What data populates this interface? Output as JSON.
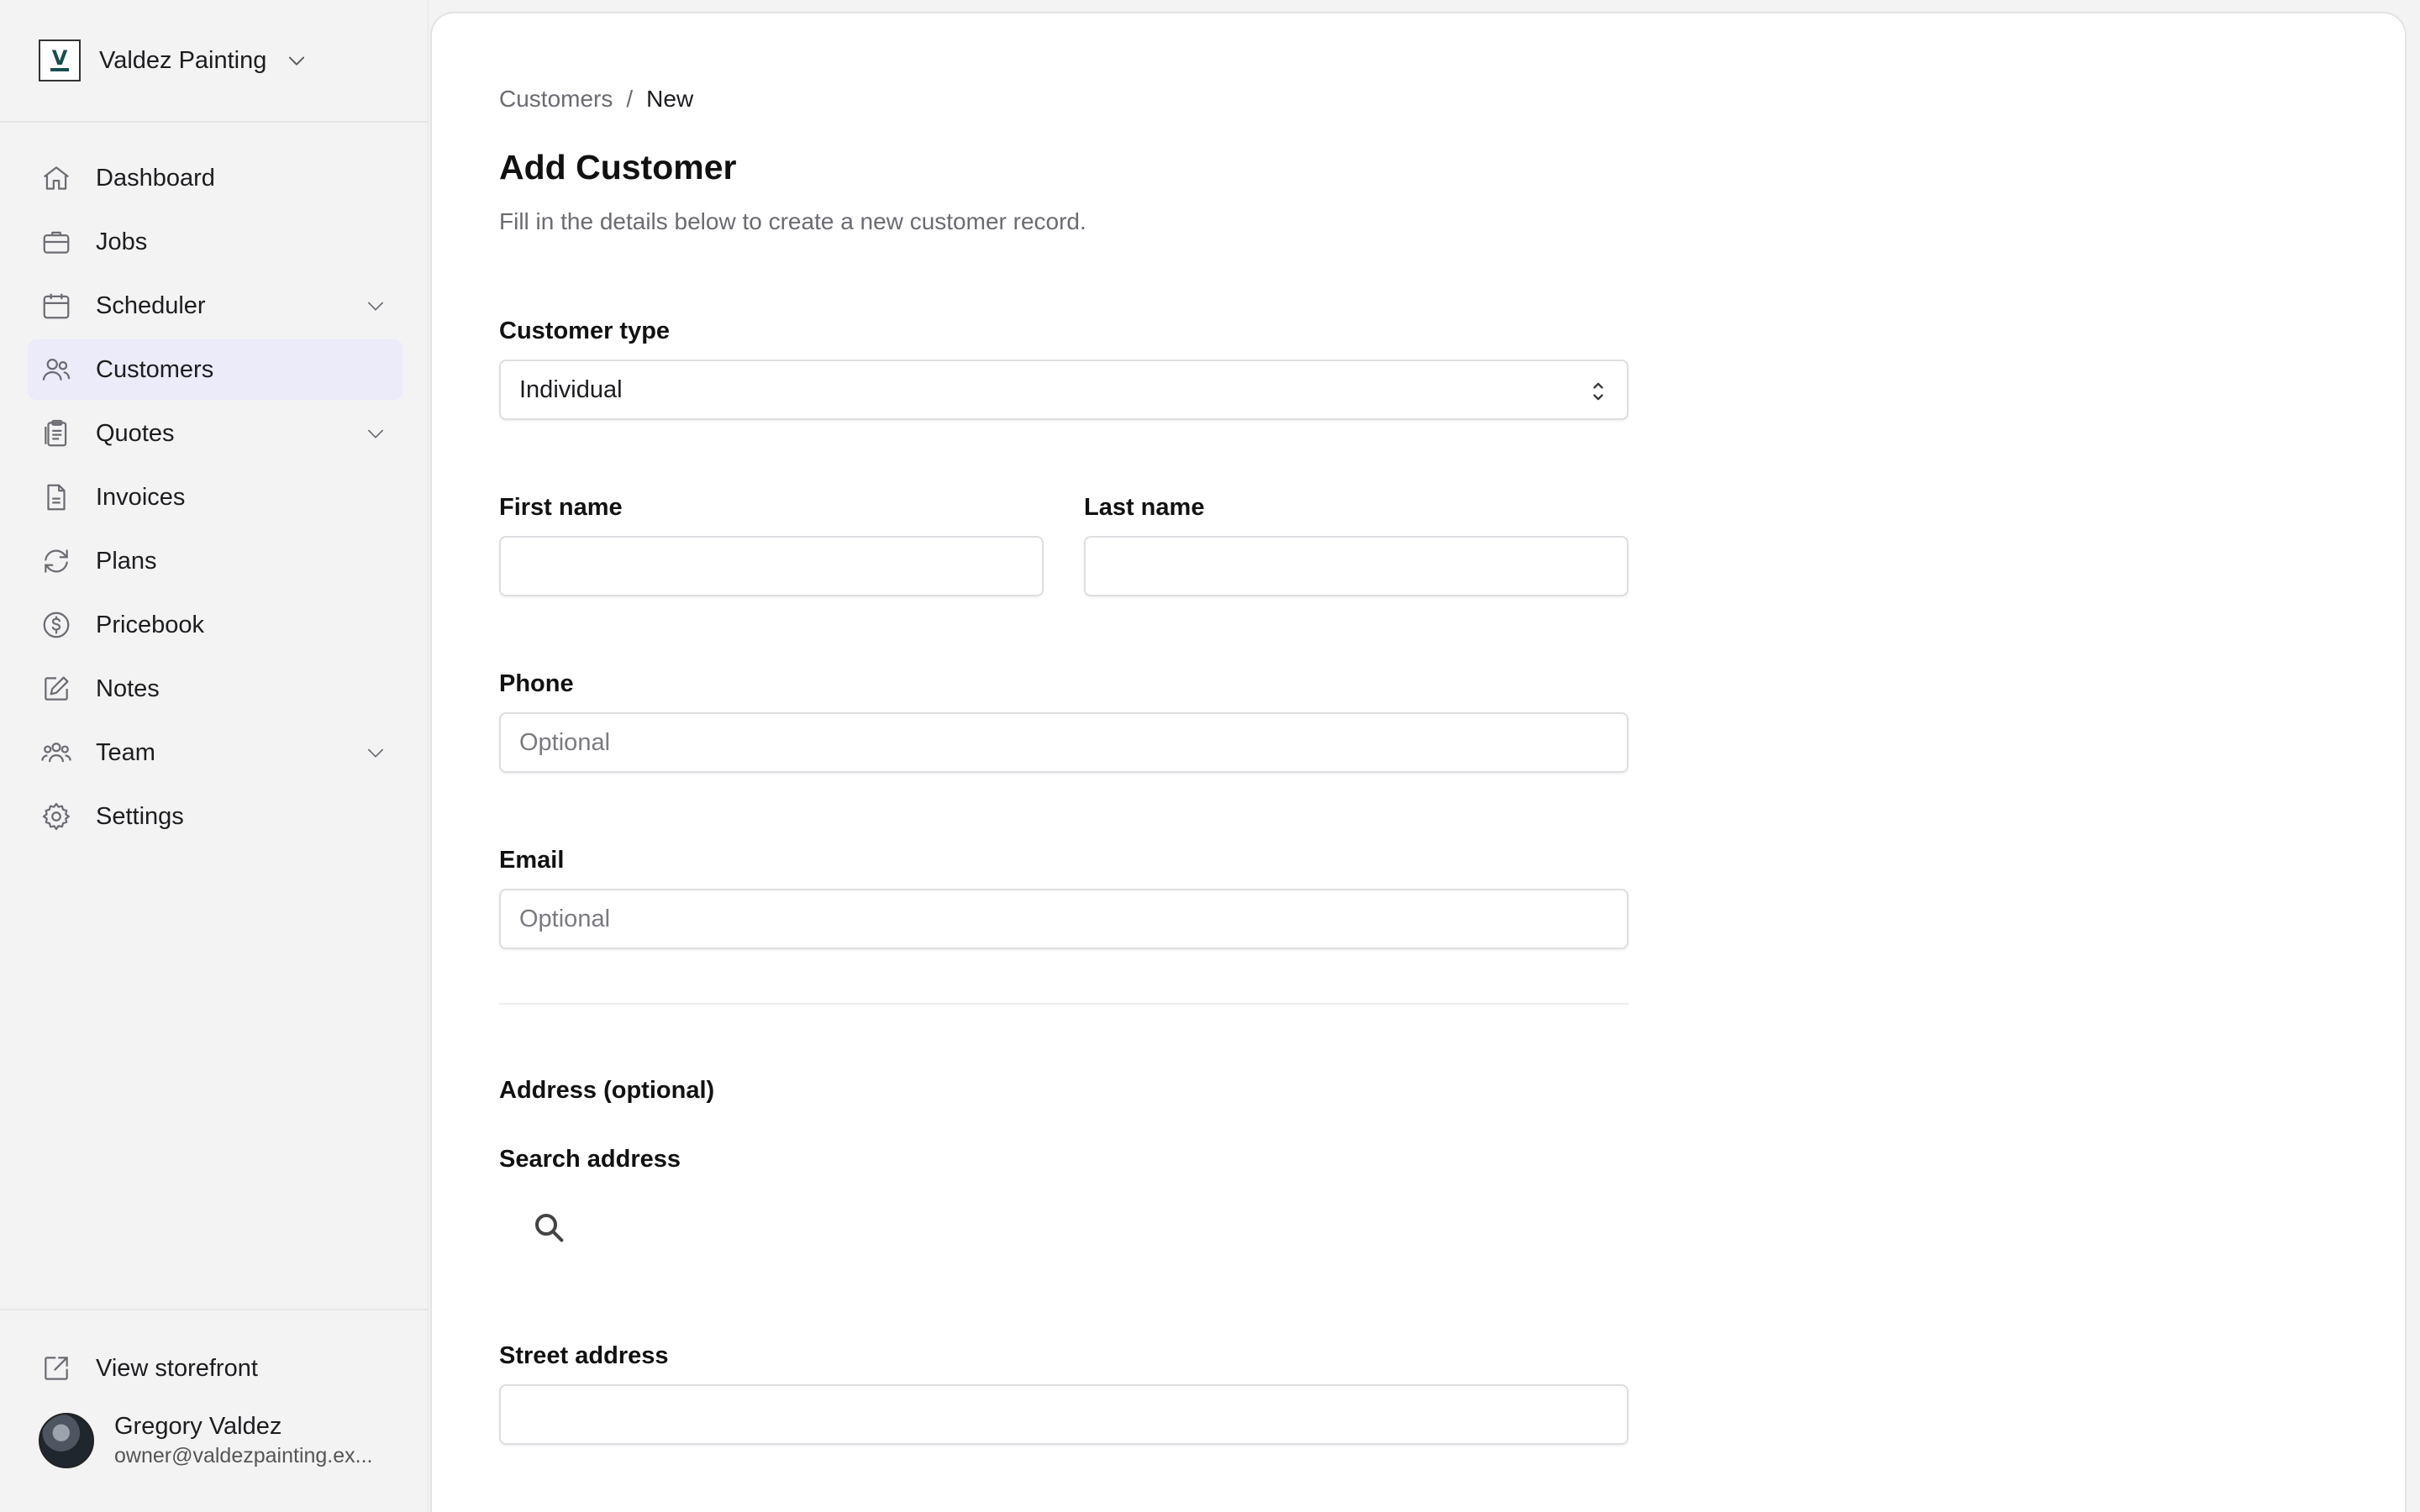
{
  "workspace": {
    "name": "Valdez Painting"
  },
  "sidebar": {
    "items": [
      {
        "label": "Dashboard",
        "icon": "home-icon",
        "expandable": false,
        "active": false
      },
      {
        "label": "Jobs",
        "icon": "briefcase-icon",
        "expandable": false,
        "active": false
      },
      {
        "label": "Scheduler",
        "icon": "calendar-icon",
        "expandable": true,
        "active": false
      },
      {
        "label": "Customers",
        "icon": "users-icon",
        "expandable": false,
        "active": true
      },
      {
        "label": "Quotes",
        "icon": "clipboard-icon",
        "expandable": true,
        "active": false
      },
      {
        "label": "Invoices",
        "icon": "document-icon",
        "expandable": false,
        "active": false
      },
      {
        "label": "Plans",
        "icon": "refresh-icon",
        "expandable": false,
        "active": false
      },
      {
        "label": "Pricebook",
        "icon": "dollar-icon",
        "expandable": false,
        "active": false
      },
      {
        "label": "Notes",
        "icon": "pencil-square-icon",
        "expandable": false,
        "active": false
      },
      {
        "label": "Team",
        "icon": "team-icon",
        "expandable": true,
        "active": false
      },
      {
        "label": "Settings",
        "icon": "gear-icon",
        "expandable": false,
        "active": false
      }
    ],
    "storefront_label": "View storefront",
    "user": {
      "name": "Gregory Valdez",
      "email": "owner@valdezpainting.ex..."
    }
  },
  "breadcrumb": {
    "parent": "Customers",
    "separator": "/",
    "current": "New"
  },
  "page": {
    "title": "Add Customer",
    "subtitle": "Fill in the details below to create a new customer record."
  },
  "form": {
    "customer_type": {
      "label": "Customer type",
      "value": "Individual"
    },
    "first_name": {
      "label": "First name",
      "value": "",
      "placeholder": ""
    },
    "last_name": {
      "label": "Last name",
      "value": "",
      "placeholder": ""
    },
    "phone": {
      "label": "Phone",
      "value": "",
      "placeholder": "Optional"
    },
    "email": {
      "label": "Email",
      "value": "",
      "placeholder": "Optional"
    },
    "address_section_title": "Address (optional)",
    "search_address": {
      "label": "Search address",
      "value": ""
    },
    "street_address": {
      "label": "Street address",
      "value": "",
      "placeholder": ""
    }
  },
  "colors": {
    "active_nav_bg": "#ebebfa",
    "sidebar_bg": "#f3f3f4",
    "panel_bg": "#ffffff"
  }
}
